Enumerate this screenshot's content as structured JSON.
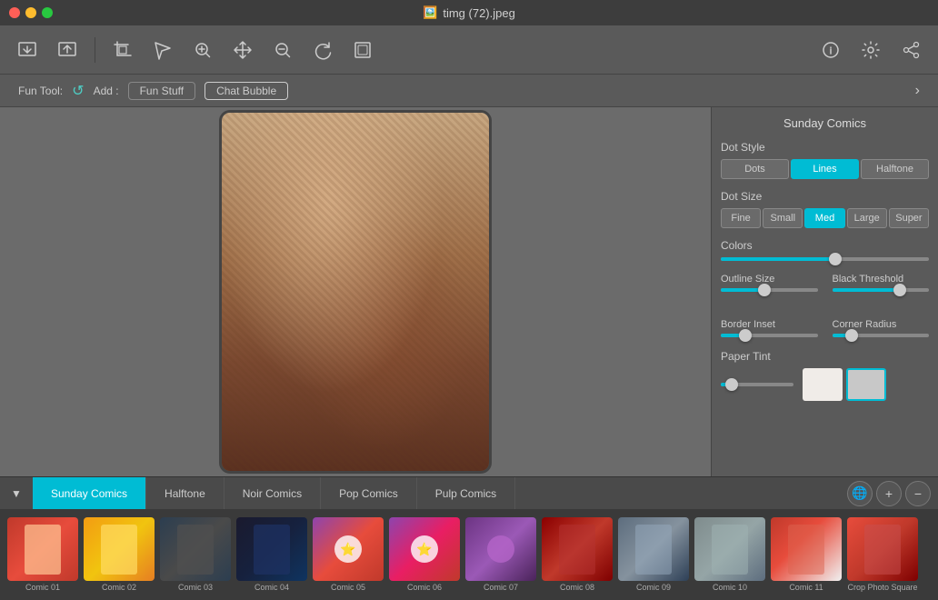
{
  "window": {
    "title": "timg (72).jpeg",
    "title_icon": "🖼️"
  },
  "toolbar": {
    "icons": [
      "crop-icon",
      "tag-icon",
      "zoom-in-icon",
      "move-icon",
      "zoom-out-icon",
      "rotate-icon",
      "frame-icon"
    ],
    "right_icons": [
      "info-icon",
      "settings-icon",
      "share-icon"
    ]
  },
  "fun_tool": {
    "label": "Fun Tool:",
    "add_label": "Add :",
    "btn_fun_stuff": "Fun Stuff",
    "btn_chat_bubble": "Chat Bubble"
  },
  "right_panel": {
    "title": "Sunday Comics",
    "dot_style_label": "Dot Style",
    "dot_style_options": [
      "Dots",
      "Lines",
      "Halftone"
    ],
    "dot_style_active": "Lines",
    "dot_size_label": "Dot Size",
    "dot_size_options": [
      "Fine",
      "Small",
      "Med",
      "Large",
      "Super"
    ],
    "dot_size_active": "Med",
    "colors_label": "Colors",
    "colors_value": 55,
    "outline_size_label": "Outline Size",
    "outline_size_value": 45,
    "black_threshold_label": "Black Threshold",
    "black_threshold_value": 70,
    "border_inset_label": "Border Inset",
    "border_inset_value": 25,
    "corner_radius_label": "Corner Radius",
    "corner_radius_value": 20,
    "paper_tint_label": "Paper Tint",
    "paper_tint_slider": 15
  },
  "tabs": {
    "items": [
      {
        "label": "Sunday Comics",
        "active": true
      },
      {
        "label": "Halftone",
        "active": false
      },
      {
        "label": "Noir Comics",
        "active": false
      },
      {
        "label": "Pop Comics",
        "active": false
      },
      {
        "label": "Pulp Comics",
        "active": false
      }
    ]
  },
  "filmstrip": {
    "items": [
      {
        "label": "Comic 01",
        "class": "thumb-01"
      },
      {
        "label": "Comic 02",
        "class": "thumb-02"
      },
      {
        "label": "Comic 03",
        "class": "thumb-03"
      },
      {
        "label": "Comic 04",
        "class": "thumb-04"
      },
      {
        "label": "Comic 05",
        "class": "thumb-05"
      },
      {
        "label": "Comic 06",
        "class": "thumb-06"
      },
      {
        "label": "Comic 07",
        "class": "thumb-07"
      },
      {
        "label": "Comic 08",
        "class": "thumb-08"
      },
      {
        "label": "Comic 09",
        "class": "thumb-09"
      },
      {
        "label": "Comic 10",
        "class": "thumb-10"
      },
      {
        "label": "Comic 11",
        "class": "thumb-11"
      },
      {
        "label": "Crop Photo Square",
        "class": "thumb-12"
      }
    ]
  }
}
